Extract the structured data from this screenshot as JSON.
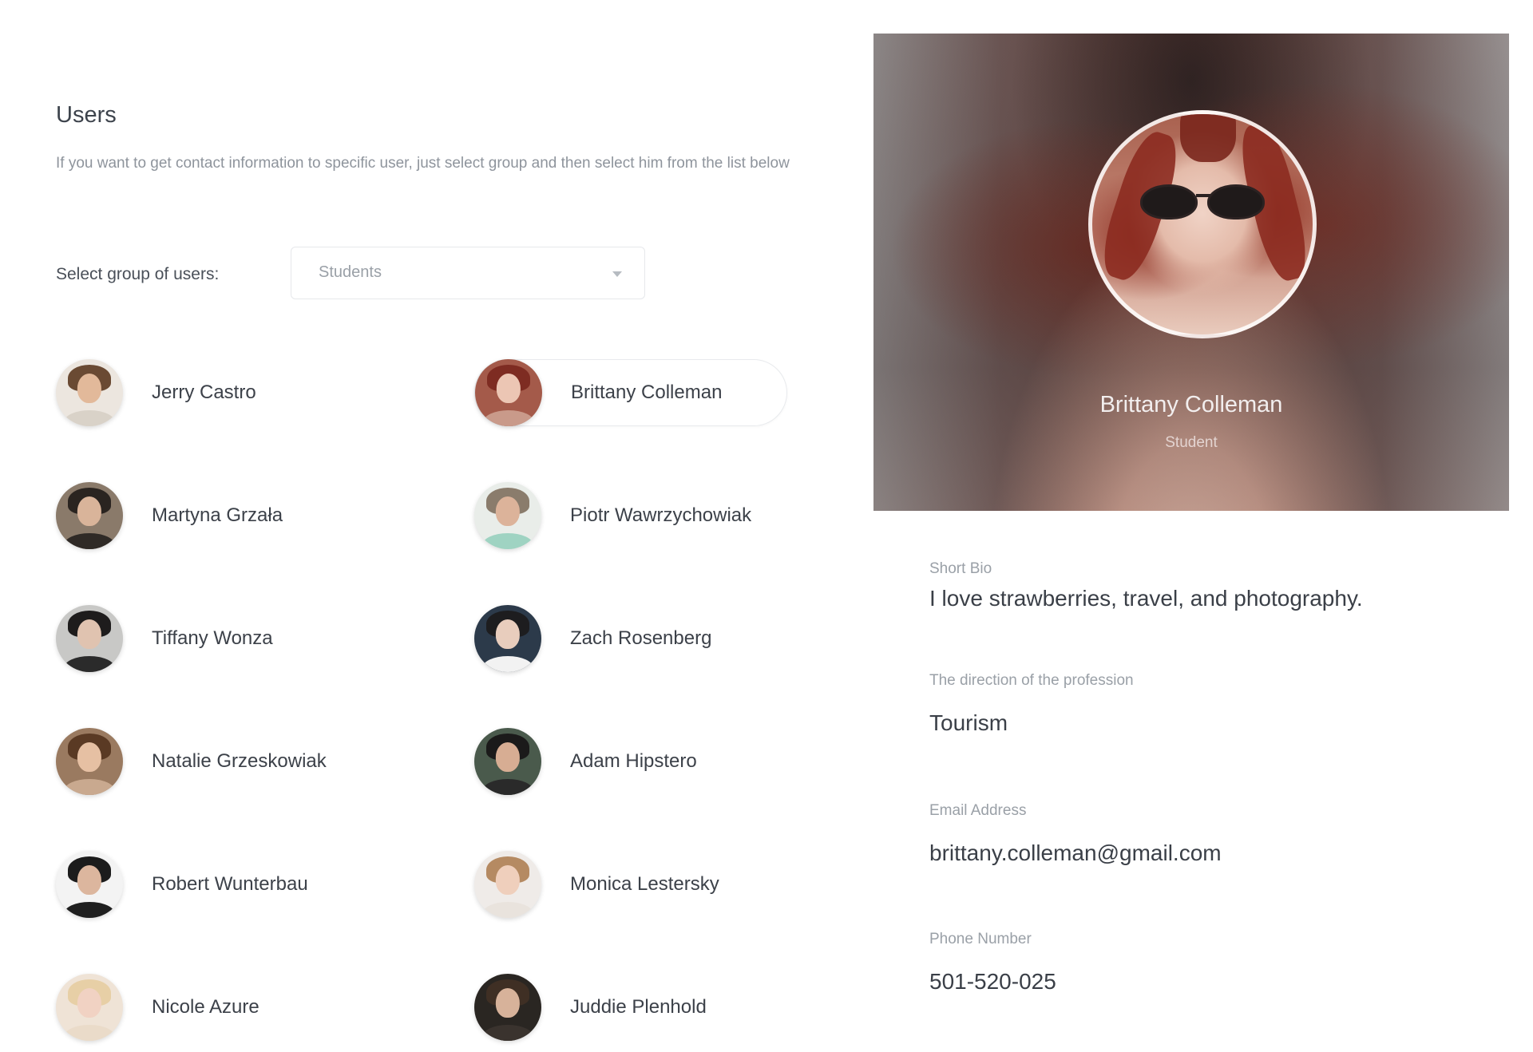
{
  "users_panel": {
    "title": "Users",
    "description": "If you want to get contact information to specific user, just select group and then select him from the list below",
    "group_label": "Select group of users:",
    "group_select": {
      "value": "Students"
    }
  },
  "users": [
    {
      "name": "Jerry Castro",
      "selected": false
    },
    {
      "name": "Brittany Colleman",
      "selected": true
    },
    {
      "name": "Martyna Grzała",
      "selected": false
    },
    {
      "name": "Piotr Wawrzychowiak",
      "selected": false
    },
    {
      "name": "Tiffany Wonza",
      "selected": false
    },
    {
      "name": "Zach Rosenberg",
      "selected": false
    },
    {
      "name": "Natalie Grzeskowiak",
      "selected": false
    },
    {
      "name": "Adam Hipstero",
      "selected": false
    },
    {
      "name": "Robert Wunterbau",
      "selected": false
    },
    {
      "name": "Monica Lestersky",
      "selected": false
    },
    {
      "name": "Nicole Azure",
      "selected": false
    },
    {
      "name": "Juddie Plenhold",
      "selected": false
    }
  ],
  "profile": {
    "name": "Brittany Colleman",
    "role": "Student",
    "bio_label": "Short Bio",
    "bio": "I love strawberries, travel, and photography.",
    "profession_label": "The direction of the profession",
    "profession": "Tourism",
    "email_label": "Email Address",
    "email": "brittany.colleman@gmail.com",
    "phone_label": "Phone Number",
    "phone": "501-520-025"
  }
}
